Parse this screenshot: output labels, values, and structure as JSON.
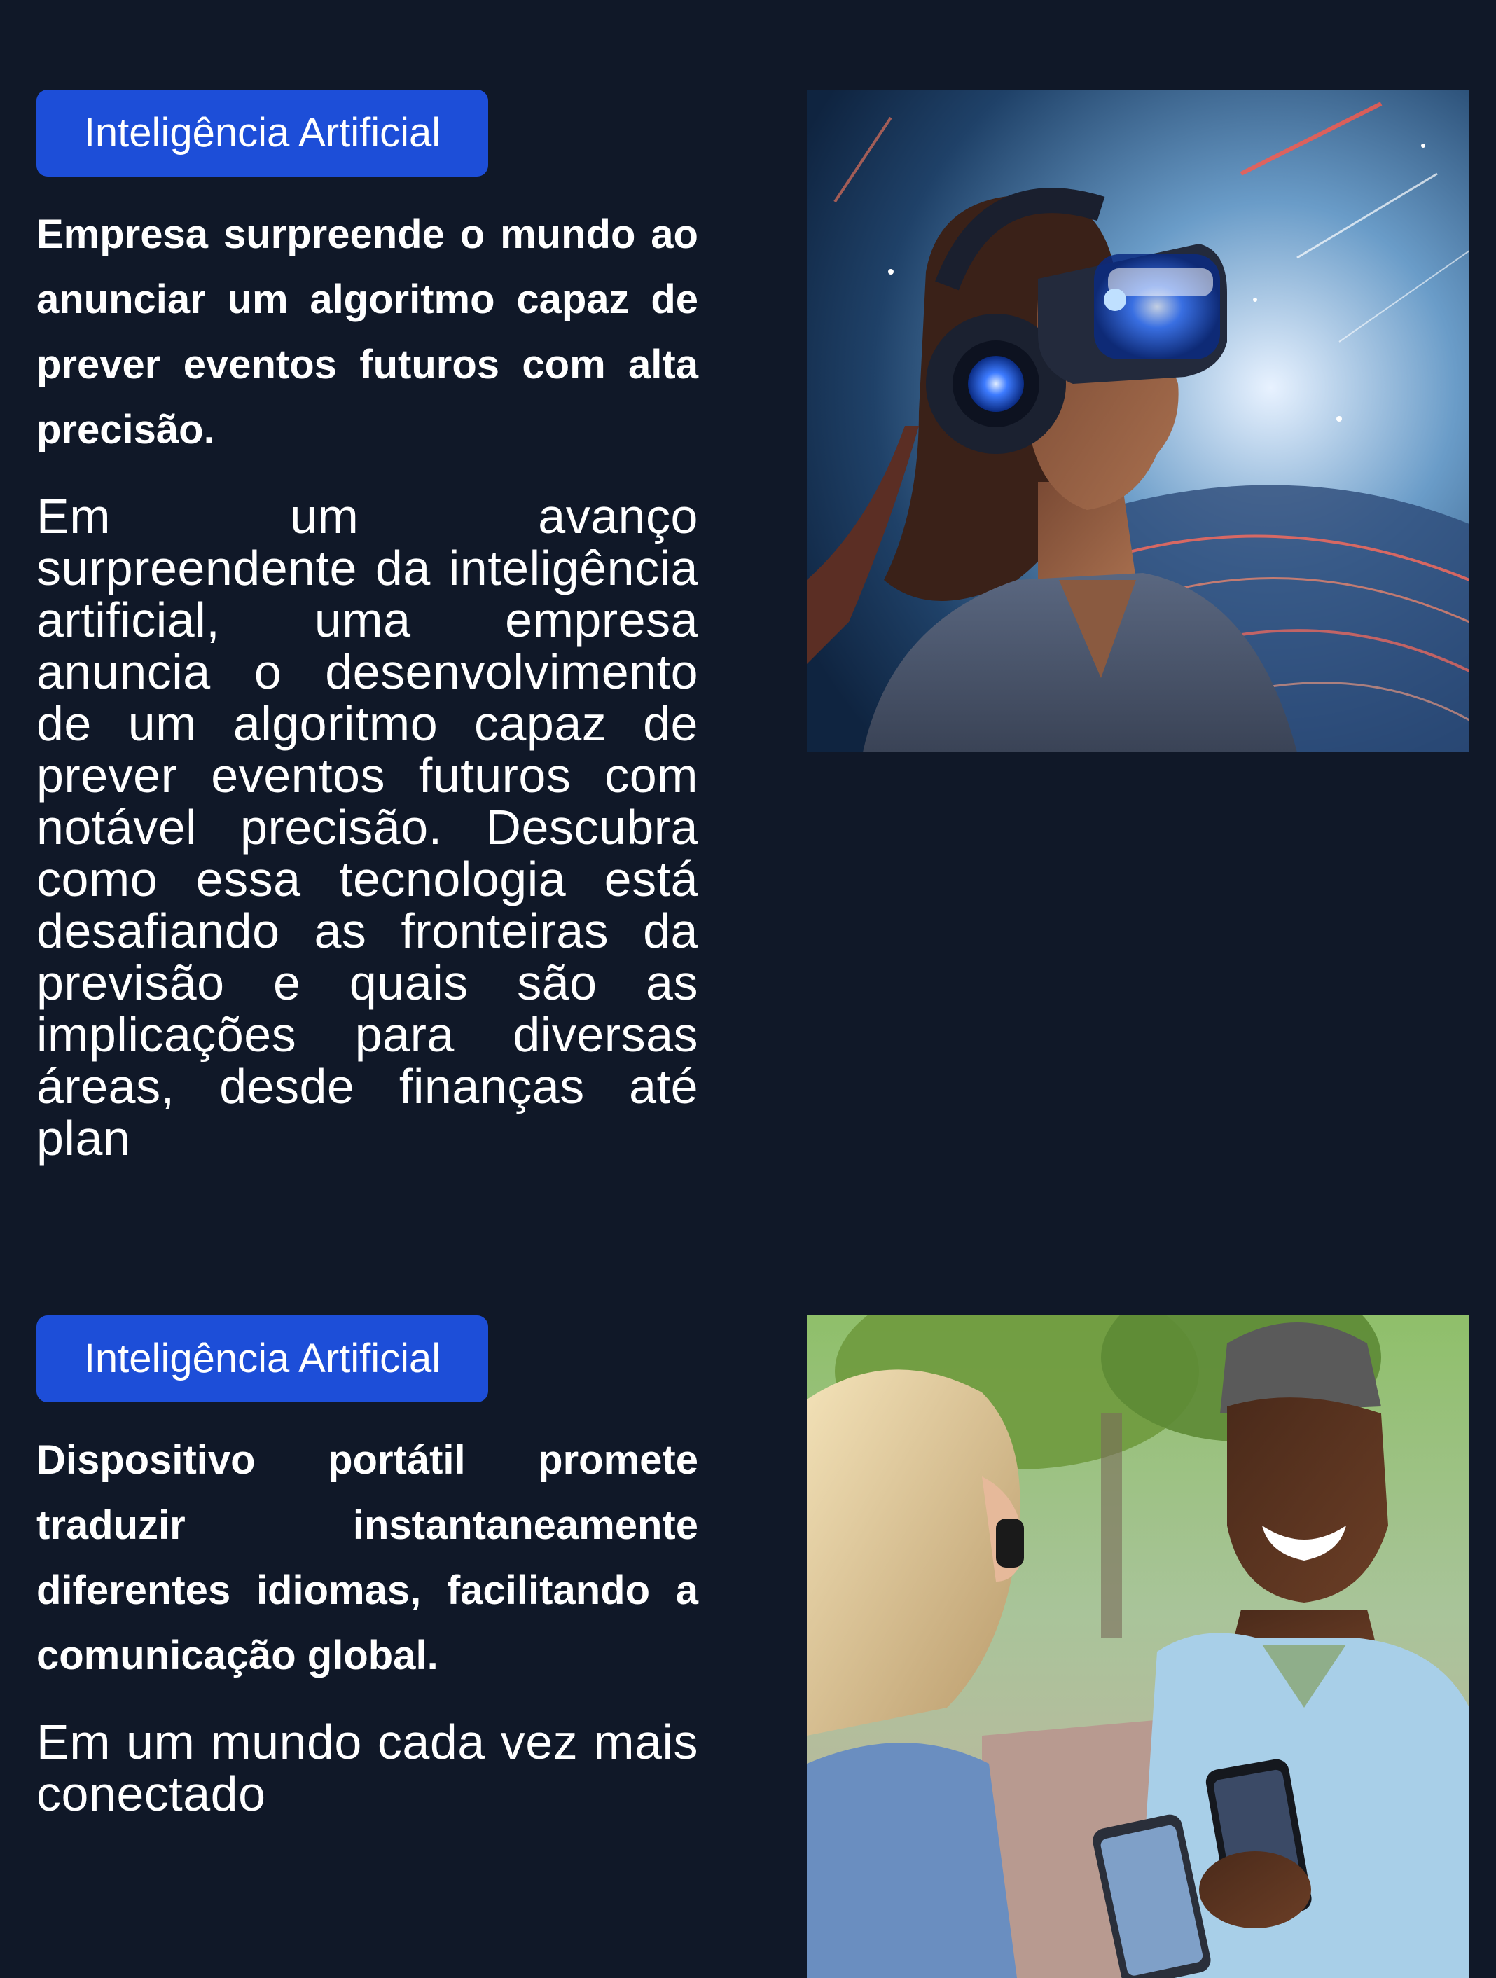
{
  "articles": [
    {
      "category": "Inteligência Artificial",
      "headline": "Empresa surpreende o mundo ao anunciar um algoritmo capaz de prever eventos futuros com alta precisão.",
      "excerpt": "Em um avanço surpreendente da inteligência artificial, uma empresa anuncia o desenvolvimento de um algoritmo capaz de prever eventos futuros com notável precisão. Descubra como essa tecnologia está desafiando as fronteiras da previsão e quais são as implicações para diversas áreas, desde finanças até plan",
      "image_icon": "vr-headset-woman-photo"
    },
    {
      "category": "Inteligência Artificial",
      "headline": "Dispositivo portátil promete traduzir instantaneamente diferentes idiomas, facilitando a comunicação global.",
      "excerpt": "Em um mundo cada vez mais conectado",
      "image_icon": "people-with-smartphone-photo"
    }
  ],
  "colors": {
    "background": "#101828",
    "badge": "#1d4ed8",
    "text": "#ffffff"
  }
}
